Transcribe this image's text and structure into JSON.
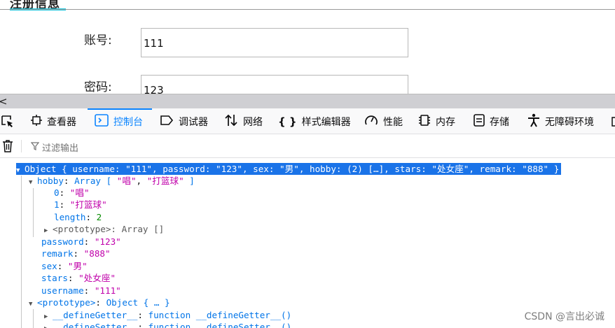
{
  "page": {
    "title": "注册信息",
    "account_label": "账号:",
    "account_value": "111",
    "password_label": "密码:",
    "password_value": "123"
  },
  "devtools": {
    "resize_glyph": "<",
    "tabs": [
      {
        "label": "查看器",
        "icon": "inspector-icon"
      },
      {
        "label": "控制台",
        "icon": "console-icon"
      },
      {
        "label": "调试器",
        "icon": "debugger-icon"
      },
      {
        "label": "网络",
        "icon": "network-icon"
      },
      {
        "label": "样式编辑器",
        "icon": "style-editor-icon"
      },
      {
        "label": "性能",
        "icon": "performance-icon"
      },
      {
        "label": "内存",
        "icon": "memory-icon"
      },
      {
        "label": "存储",
        "icon": "storage-icon"
      },
      {
        "label": "无障碍环境",
        "icon": "accessibility-icon"
      }
    ],
    "active_tab": "控制台",
    "accent": "#0a84ff",
    "filter_placeholder": "过滤输出"
  },
  "console": {
    "object_line": {
      "prefix": "Object { ",
      "username_key": "username",
      "username_val": "\"111\"",
      "password_key": "password",
      "password_val": "\"123\"",
      "sex_key": "sex",
      "sex_val": "\"男\"",
      "hobby_key": "hobby",
      "hobby_val": "(2) […]",
      "stars_key": "stars",
      "stars_val": "\"处女座\"",
      "remark_key": "remark",
      "remark_val": "\"888\"",
      "suffix": " }"
    },
    "hobby": {
      "key": "hobby",
      "type": "Array",
      "preview_open": "[ ",
      "item0": "\"唱\"",
      "sep": ", ",
      "item1": "\"打篮球\"",
      "preview_close": " ]"
    },
    "hobby_items": [
      {
        "key": "0",
        "value": "\"唱\""
      },
      {
        "key": "1",
        "value": "\"打篮球\""
      }
    ],
    "length": {
      "key": "length",
      "value": "2"
    },
    "array_proto": {
      "key": "<prototype>",
      "value": "Array []"
    },
    "props": [
      {
        "key": "password",
        "value": "\"123\""
      },
      {
        "key": "remark",
        "value": "\"888\""
      },
      {
        "key": "sex",
        "value": "\"男\""
      },
      {
        "key": "stars",
        "value": "\"处女座\""
      },
      {
        "key": "username",
        "value": "\"111\""
      }
    ],
    "obj_proto": {
      "key": "<prototype>",
      "value": "Object { … }"
    },
    "getters": [
      {
        "key": "__defineGetter__",
        "value": "function __defineGetter__()"
      },
      {
        "key": "__defineSetter__",
        "value": "function __defineSetter__()"
      }
    ],
    "selection_color": "#1a73e8"
  },
  "watermark": "CSDN @言出必诚"
}
